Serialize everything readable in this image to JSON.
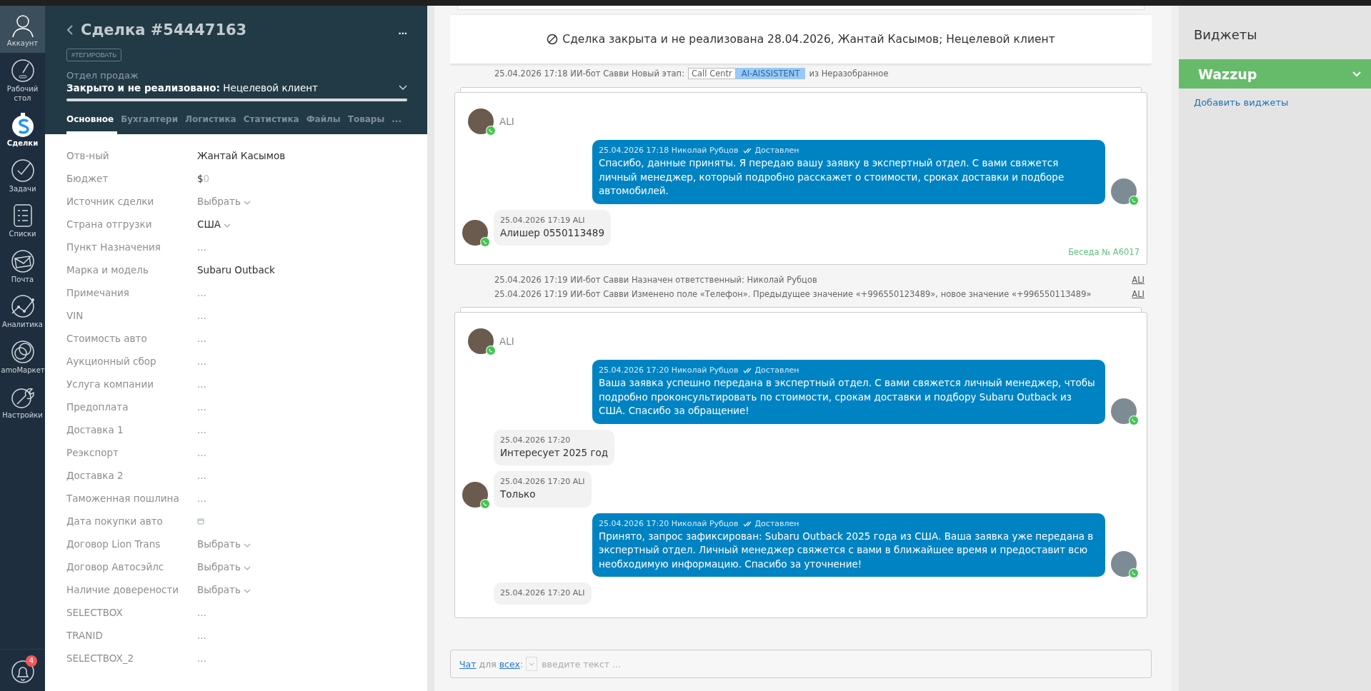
{
  "nav": {
    "items": [
      {
        "label": "Аккаунт",
        "kind": "user",
        "selected": false
      },
      {
        "label": "Рабочий стол",
        "kind": "gauge",
        "selected": false
      },
      {
        "label": "Сделки",
        "kind": "dollar",
        "selected": true
      },
      {
        "label": "Задачи",
        "kind": "check",
        "selected": false
      },
      {
        "label": "Списки",
        "kind": "list",
        "selected": false
      },
      {
        "label": "Почта",
        "kind": "mail",
        "selected": false
      },
      {
        "label": "Аналитика",
        "kind": "chart",
        "selected": false
      },
      {
        "label": "amoМаркет",
        "kind": "market",
        "selected": false
      },
      {
        "label": "Настройки",
        "kind": "wrench",
        "selected": false
      }
    ],
    "notifications": "4"
  },
  "deal": {
    "title": "Сделка #54447163",
    "more": "...",
    "tag_button": "#ТЕГИРОВАТЬ",
    "pipeline": "Отдел продаж",
    "status": "Закрыто и не реализовано:",
    "reason": "Нецелевой клиент",
    "level": 1,
    "tabs": [
      {
        "label": "Основное",
        "selected": true
      },
      {
        "label": "Бухгалтери",
        "selected": false
      },
      {
        "label": "Логистика",
        "selected": false
      },
      {
        "label": "Статистика",
        "selected": false
      },
      {
        "label": "Файлы",
        "selected": false
      },
      {
        "label": "Товары",
        "selected": false
      }
    ],
    "tabs_more": "..."
  },
  "fields": [
    {
      "label": "Отв-ный",
      "kind": "text",
      "value": "Жантай Касымов"
    },
    {
      "label": "Бюджет",
      "kind": "budget",
      "currency": "$",
      "placeholder": "0"
    },
    {
      "label": "Источник сделки",
      "kind": "select",
      "placeholder": "Выбрать"
    },
    {
      "label": "Страна отгрузки",
      "kind": "select_set",
      "value": "США"
    },
    {
      "label": "Пункт Назначения",
      "kind": "empty",
      "placeholder": "..."
    },
    {
      "label": "Марка и модель",
      "kind": "text",
      "value": "Subaru Outback"
    },
    {
      "label": "Примечания",
      "kind": "empty",
      "placeholder": "..."
    },
    {
      "label": "VIN",
      "kind": "empty",
      "placeholder": "..."
    },
    {
      "label": "Стоимость авто",
      "kind": "empty",
      "placeholder": "..."
    },
    {
      "label": "Аукционный сбор",
      "kind": "empty",
      "placeholder": "..."
    },
    {
      "label": "Услуга компании",
      "kind": "empty",
      "placeholder": "..."
    },
    {
      "label": "Предоплата",
      "kind": "empty",
      "placeholder": "..."
    },
    {
      "label": "Доставка 1",
      "kind": "empty",
      "placeholder": "..."
    },
    {
      "label": "Реэкспорт",
      "kind": "empty",
      "placeholder": "..."
    },
    {
      "label": "Доставка 2",
      "kind": "empty",
      "placeholder": "..."
    },
    {
      "label": "Таможенная пошлина",
      "kind": "empty",
      "placeholder": "..."
    },
    {
      "label": "Дата покупки авто",
      "kind": "date"
    },
    {
      "label": "Договор Lion Trans",
      "kind": "select",
      "placeholder": "Выбрать"
    },
    {
      "label": "Договор Автосэйлс",
      "kind": "select",
      "placeholder": "Выбрать"
    },
    {
      "label": "Наличие доверености",
      "kind": "select",
      "placeholder": "Выбрать"
    },
    {
      "label": "SELECTBOX",
      "kind": "empty",
      "placeholder": "..."
    },
    {
      "label": "TRANID",
      "kind": "empty",
      "placeholder": "..."
    },
    {
      "label": "SELECTBOX_2",
      "kind": "empty",
      "placeholder": "..."
    }
  ],
  "feed": {
    "banner": "Сделка закрыта и не реализована 28.04.2026, Жантай Касымов; Нецелевой клиент",
    "items": [
      {
        "kind": "stage",
        "text": "25.04.2026 17:18 ИИ-бот Савви Новый этап:",
        "from_stage": "Call Centr",
        "to_stage": "AI-AISSISTENT",
        "suffix": "из Неразобранное"
      },
      {
        "kind": "conversation",
        "contact": "ALI",
        "footer": "Беседа № A6017",
        "messages": [
          {
            "kind": "out",
            "meta": "25.04.2026 17:18 Николай Рубцов",
            "status": "Доставлен",
            "text": "Спасибо, данные приняты. Я передаю вашу заявку в экспертный отдел. С вами свяжется личный менеджер, который подробно расскажет о стоимости, сроках доставки и подборе автомобилей.",
            "avatar": true
          },
          {
            "kind": "in",
            "meta": "25.04.2026 17:19 ALI",
            "text": "Алишер 0550113489",
            "avatar": true
          }
        ]
      },
      {
        "kind": "note",
        "text": "25.04.2026 17:19 ИИ-бот Савви Назначен ответственный: Николай Рубцов",
        "link": "ALI"
      },
      {
        "kind": "note",
        "text": "25.04.2026 17:19 ИИ-бот Савви Изменено поле «Телефон». Предыдущее значение «+996550123489», новое значение «+996550113489»",
        "link": "ALI"
      },
      {
        "kind": "conversation",
        "contact": "ALI",
        "messages": [
          {
            "kind": "out",
            "meta": "25.04.2026 17:20 Николай Рубцов",
            "status": "Доставлен",
            "text": "Ваша заявка успешно передана в экспертный отдел. С вами свяжется личный менеджер, чтобы подробно проконсультировать по стоимости, срокам доставки и подбору Subaru Outback из США. Спасибо за обращение!",
            "avatar": true
          },
          {
            "kind": "in",
            "meta": "25.04.2026 17:20",
            "text": "Интересует 2025 год",
            "avatar": false
          },
          {
            "kind": "in",
            "meta": "25.04.2026 17:20 ALI",
            "text": "Только",
            "avatar": true
          },
          {
            "kind": "out",
            "meta": "25.04.2026 17:20 Николай Рубцов",
            "status": "Доставлен",
            "text": "Принято, запрос зафиксирован: Subaru Outback 2025 года из США. Ваша заявка уже передана в экспертный отдел. Личный менеджер свяжется с вами в ближайшее время и предоставит всю необходимую информацию. Спасибо за уточнение!",
            "avatar": true
          },
          {
            "kind": "in",
            "meta": "25.04.2026 17:20 ALI",
            "avatar": false
          }
        ]
      }
    ]
  },
  "composer": {
    "chat_link": "Чат",
    "for": "для",
    "all_link": "всех",
    "colon": ":",
    "placeholder": "введите текст ..."
  },
  "widgets": {
    "title": "Виджеты",
    "items": [
      {
        "name": "Wazzup",
        "expanded": false
      }
    ],
    "add_link": "Добавить виджеты"
  }
}
